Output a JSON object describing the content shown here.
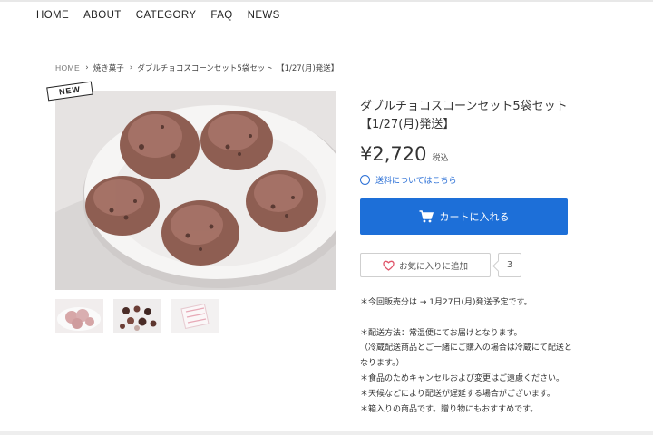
{
  "nav": {
    "items": [
      "HOME",
      "ABOUT",
      "CATEGORY",
      "FAQ",
      "NEWS"
    ]
  },
  "breadcrumb": {
    "home": "HOME",
    "category": "焼き菓子",
    "current": "ダブルチョコスコーンセット5袋セット　【1/27(月)発送】"
  },
  "product": {
    "badge": "NEW",
    "title_line1": "ダブルチョコスコーンセット5袋セット",
    "title_line2": "【1/27(月)発送】",
    "price": "¥2,720",
    "tax_label": "税込",
    "shipping_link": "送料についてはこちら",
    "cart_button": "カートに入れる",
    "favorite_button": "お気に入りに追加",
    "favorite_count": "3"
  },
  "description": {
    "line1": "＊今回販売分は → 1月27日(月)発送予定です。",
    "line2": "＊配送方法：常温便にてお届けとなります。",
    "line3": "（冷蔵配送商品とご一緒にご購入の場合は冷蔵にて配送と",
    "line4": "なります。）",
    "line5": "＊食品のためキャンセルおよび変更はご遠慮ください。",
    "line6": "＊天候などにより配送が遅延する場合がございます。",
    "line7": "＊箱入りの商品です。贈り物にもおすすめです。"
  },
  "icons": {
    "info": "info-icon",
    "cart": "cart-icon",
    "heart": "heart-icon",
    "chevron": "chevron-right-icon"
  },
  "colors": {
    "accent": "#1d6fd8",
    "link": "#2a6fd6",
    "heart": "#e0556a"
  }
}
